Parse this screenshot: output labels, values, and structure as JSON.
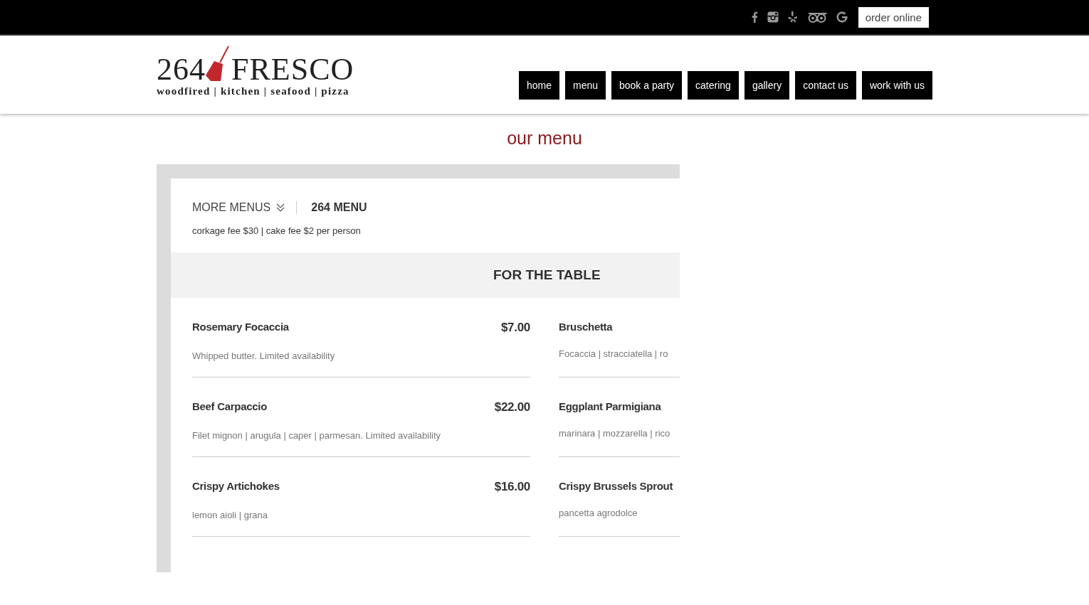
{
  "topbar": {
    "order_button": "order online"
  },
  "logo": {
    "number": "264",
    "name": "FRESCO",
    "tagline": "woodfired | kitchen | seafood | pizza"
  },
  "nav": [
    "home",
    "menu",
    "book a party",
    "catering",
    "gallery",
    "contact us",
    "work with us"
  ],
  "page_title": "our menu",
  "menu": {
    "more_menus": "MORE MENUS",
    "current_menu": "264 MENU",
    "note": "corkage fee $30 | cake fee $2 per person",
    "section": "FOR THE TABLE",
    "items": [
      {
        "name": "Rosemary Focaccia",
        "price": "$7.00",
        "description": "Whipped butter. Limited availability"
      },
      {
        "name": "Bruschetta",
        "description": "Focaccia | stracciatella | ro"
      },
      {
        "name": "Beef Carpaccio",
        "price": "$22.00",
        "description": "Filet mignon | arugula | caper | parmesan. Limited availability"
      },
      {
        "name": "Eggplant Parmigiana",
        "description": "marinara | mozzarella | rico"
      },
      {
        "name": "Crispy Artichokes",
        "price": "$16.00",
        "description": "lemon aioli | grana"
      },
      {
        "name": "Crispy Brussels Sprout",
        "description": "pancetta agrodolce"
      }
    ]
  }
}
